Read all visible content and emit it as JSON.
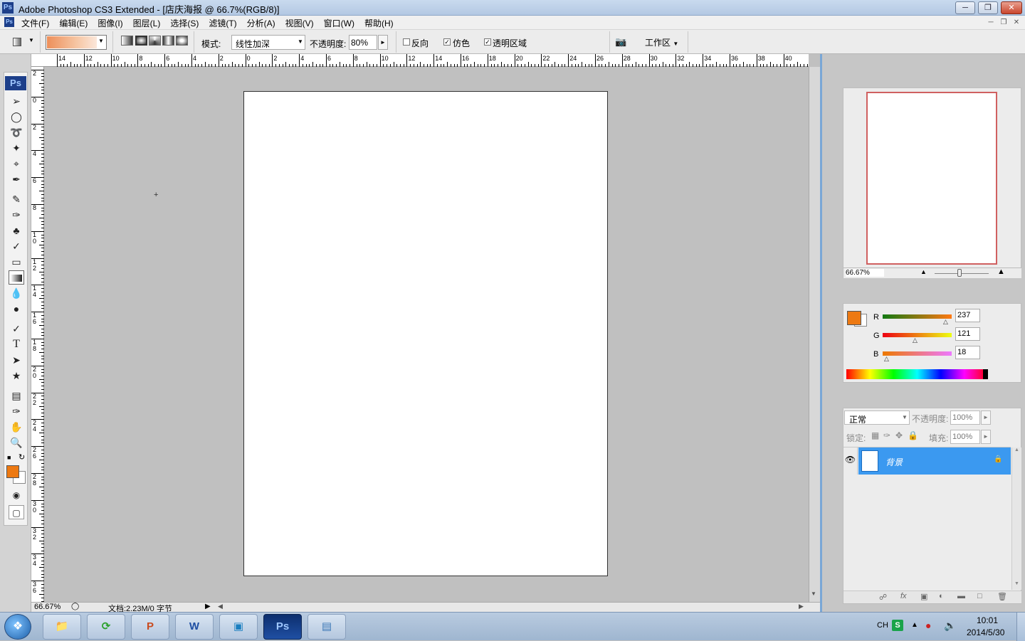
{
  "window": {
    "title": "Adobe Photoshop CS3 Extended - [店庆海报 @ 66.7%(RGB/8)]",
    "app_icon_label": "Ps"
  },
  "menu": {
    "items": [
      "文件(F)",
      "编辑(E)",
      "图像(I)",
      "图层(L)",
      "选择(S)",
      "滤镜(T)",
      "分析(A)",
      "视图(V)",
      "窗口(W)",
      "帮助(H)"
    ]
  },
  "options": {
    "mode_label": "模式:",
    "mode_value": "线性加深",
    "opacity_label": "不透明度:",
    "opacity_value": "80%",
    "reverse_label": "反向",
    "reverse_checked": false,
    "dither_label": "仿色",
    "dither_checked": true,
    "transparency_label": "透明区域",
    "transparency_checked": true,
    "workspace_label": "工作区"
  },
  "toolbox": {
    "logo": "Ps",
    "foreground_color": "#ED7912",
    "background_color": "#ffffff"
  },
  "hruler": {
    "labels": [
      "14",
      "12",
      "10",
      "8",
      "6",
      "4",
      "2",
      "0",
      "2",
      "4",
      "6",
      "8",
      "10",
      "12",
      "14",
      "16",
      "18",
      "20",
      "22",
      "24",
      "26",
      "28",
      "30",
      "32",
      "34",
      "36",
      "38",
      "40"
    ]
  },
  "vruler": {
    "labels": [
      "2",
      "0",
      "2",
      "4",
      "6",
      "8",
      "10",
      "12",
      "14",
      "16",
      "18",
      "20",
      "22",
      "24",
      "26",
      "28",
      "30",
      "32",
      "34",
      "36"
    ]
  },
  "status": {
    "zoom": "66.67%",
    "doc_info": "文档:2.23M/0 字节"
  },
  "navigator": {
    "zoom": "66.67%",
    "frame_color": "#d06060"
  },
  "color_panel": {
    "r_label": "R",
    "g_label": "G",
    "b_label": "B",
    "r_value": "237",
    "g_value": "121",
    "b_value": "18",
    "swatch": "#ED7912"
  },
  "layers_panel": {
    "blend_mode": "正常",
    "opacity_label": "不透明度:",
    "opacity_value": "100%",
    "lock_label": "锁定:",
    "fill_label": "填充:",
    "fill_value": "100%",
    "layer_name": "背景",
    "selected_color": "#3b99f0"
  },
  "taskbar": {
    "apps": [
      "explorer",
      "refresh",
      "powerpoint",
      "word",
      "paint",
      "photoshop",
      "image-viewer"
    ],
    "ps_label": "Ps",
    "word_label": "W",
    "ppt_label": "P",
    "lang": "CH",
    "ime": "S",
    "time": "10:01",
    "date": "2014/5/30"
  }
}
